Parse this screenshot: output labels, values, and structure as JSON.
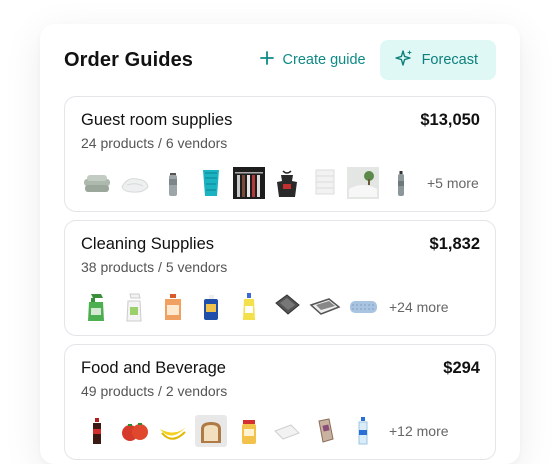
{
  "header": {
    "title": "Order Guides",
    "create_label": "Create guide",
    "forecast_label": "Forecast"
  },
  "guides": [
    {
      "name": "Guest room supplies",
      "meta": "24 products / 6 vendors",
      "total": "$13,050",
      "more": "+5 more",
      "thumbs": [
        "folded-towels-icon",
        "white-towel-icon",
        "spray-canister-icon",
        "glass-icon",
        "hangers-icon",
        "apron-icon",
        "towel-stack-icon",
        "plant-pillow-icon",
        "spray-bottle-icon"
      ]
    },
    {
      "name": "Cleaning Supplies",
      "meta": "38 products / 5 vendors",
      "total": "$1,832",
      "more": "+24 more",
      "thumbs": [
        "green-spray-bottle-icon",
        "trigger-spray-icon",
        "cleaner-jug-icon",
        "blue-bottle-icon",
        "yellow-bottle-icon",
        "floor-mat-icon",
        "dish-rack-icon",
        "mop-head-icon"
      ]
    },
    {
      "name": "Food and Beverage",
      "meta": "49 products / 2 vendors",
      "total": "$294",
      "more": "+12 more",
      "thumbs": [
        "cola-bottle-icon",
        "tomatoes-icon",
        "bananas-icon",
        "bread-icon",
        "jar-icon",
        "napkins-icon",
        "cups-icon",
        "water-bottle-icon"
      ]
    }
  ]
}
